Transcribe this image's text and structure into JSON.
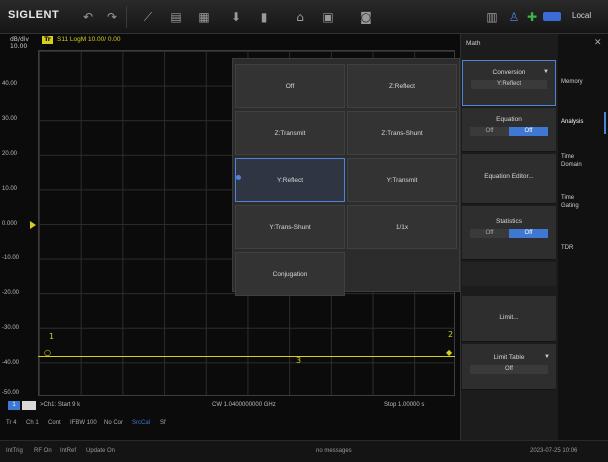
{
  "toolbar": {
    "logo": "SIGLENT",
    "local": "Local"
  },
  "trace": {
    "scale_top": "dB/div",
    "scale_top_val": "10.00",
    "tag": "Tr 1",
    "info": "S11 LogM 10.00/ 0.00",
    "y_labels": [
      "50.00",
      "40.00",
      "30.00",
      "20.00",
      "10.00",
      "0.000",
      "-10.00",
      "-20.00",
      "-30.00",
      "-40.00",
      "-50.00"
    ],
    "marker_left": "1",
    "marker_right": "2",
    "marker_mid": "3"
  },
  "status": {
    "left_tag": "1",
    "start": ">Ch1: Start 9 k",
    "center": "CW 1.0400000000 GHz",
    "stop": "Stop 1.00000 s",
    "row2": [
      "Tr 4",
      "Ch 1",
      "Cont",
      "IFBW 100",
      "No Cor",
      "SrcCal",
      "Sf"
    ],
    "bottom": [
      "IntTrig",
      "RF On",
      "IntRef",
      "Update On"
    ],
    "bottom_center": "no messages",
    "datetime": "2023-07-25 10:06"
  },
  "popup": {
    "items": [
      "Off",
      "Z:Reflect",
      "Z:Transmit",
      "Z:Trans-Shunt",
      "Y:Reflect",
      "Y:Transmit",
      "Y:Trans-Shunt",
      "1/1x",
      "Conjugation"
    ],
    "selected": "Y:Reflect"
  },
  "panel": {
    "title": "Math",
    "conversion_label": "Conversion",
    "conversion_value": "Y:Reflect",
    "equation_label": "Equation",
    "equation_editor": "Equation Editor...",
    "statistics_label": "Statistics",
    "toggle_off": "Off",
    "toggle_on": "Off",
    "limit_label": "Limit...",
    "limit_table_label": "Limit Table",
    "limit_table_value": "Off"
  },
  "tabs": [
    "Memory",
    "Analysis",
    "Time Domain",
    "Time Gating",
    "TDR"
  ]
}
